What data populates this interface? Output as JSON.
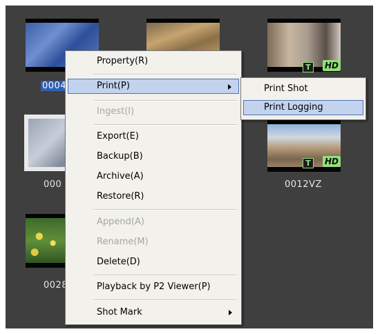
{
  "clips": [
    {
      "label": "0004",
      "selected": true
    },
    {
      "label": ""
    },
    {
      "label": "",
      "badges": [
        "T",
        "HD"
      ]
    },
    {
      "label": "000"
    },
    {
      "label": "0012VZ",
      "badges": [
        "T",
        "HD"
      ]
    },
    {
      "label": "0028"
    }
  ],
  "context_menu": {
    "items": [
      {
        "label": "Property(R)"
      },
      {
        "label": "Print(P)"
      },
      {
        "label": "Ingest(I)"
      },
      {
        "label": "Export(E)"
      },
      {
        "label": "Backup(B)"
      },
      {
        "label": "Archive(A)"
      },
      {
        "label": "Restore(R)"
      },
      {
        "label": "Append(A)"
      },
      {
        "label": "Rename(M)"
      },
      {
        "label": "Delete(D)"
      },
      {
        "label": "Playback by P2 Viewer(P)"
      },
      {
        "label": "Shot Mark"
      }
    ]
  },
  "print_submenu": {
    "items": [
      {
        "label": "Print Shot"
      },
      {
        "label": "Print Logging"
      }
    ]
  },
  "colors": {
    "panel_background": "#3f3f3f",
    "menu_background": "#f2f1ec",
    "highlight_background": "#c3d3ee",
    "highlight_border": "#4e73b0",
    "badge_green": "#8fe07a",
    "selected_label_bg": "#2f5fb3"
  }
}
